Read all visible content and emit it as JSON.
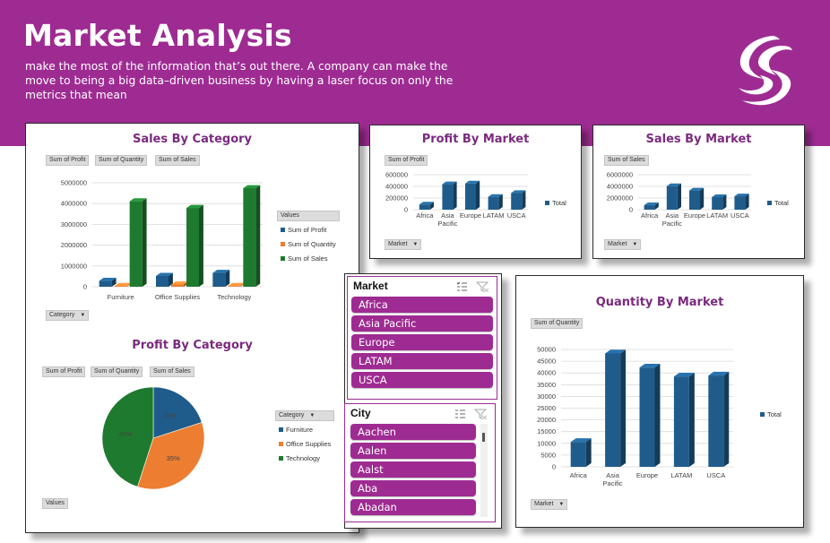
{
  "header": {
    "title": "Market Analysis",
    "subtitle_lines": [
      "make the most of the information that’s out there. A company can make the",
      " move to being a big data–driven business by having a laser focus on only the",
      "metrics that mean"
    ]
  },
  "colors": {
    "banner": "#9e2b92",
    "title_purple": "#7a2a7e",
    "series_blue": "#1f5c8b",
    "series_orange": "#ed7d31",
    "series_green": "#1e7a2f"
  },
  "panels": {
    "sales_by_category": {
      "field_buttons": [
        "Sum of Profit",
        "Sum of Quantity",
        "Sum of Sales"
      ],
      "axis_button": "Category",
      "legend_title": "Values"
    },
    "profit_by_category": {
      "field_buttons": [
        "Sum of Profit",
        "Sum of Quantity",
        "Sum of Sales"
      ],
      "legend_button": "Category",
      "values_button": "Values"
    },
    "profit_by_market": {
      "field_button": "Sum of Profit",
      "axis_button": "Market"
    },
    "sales_by_market": {
      "field_button": "Sum of Sales",
      "axis_button": "Market"
    },
    "quantity_by_market": {
      "field_button": "Sum of Quantity",
      "axis_button": "Market"
    }
  },
  "slicers": {
    "market": {
      "header": "Market",
      "items": [
        "Africa",
        "Asia Pacific",
        "Europe",
        "LATAM",
        "USCA"
      ]
    },
    "city": {
      "header": "City",
      "items": [
        "Aachen",
        "Aalen",
        "Aalst",
        "Aba",
        "Abadan"
      ]
    }
  },
  "chart_data": [
    {
      "id": "sales_by_category",
      "type": "bar",
      "title": "Sales By Category",
      "categories": [
        "Furniture",
        "Office Supplies",
        "Technology"
      ],
      "series": [
        {
          "name": "Sum of Profit",
          "values": [
            285000,
            518000,
            664000
          ]
        },
        {
          "name": "Sum of Quantity",
          "values": [
            35000,
            108000,
            36000
          ]
        },
        {
          "name": "Sum of Sales",
          "values": [
            4110000,
            3790000,
            4740000
          ]
        }
      ],
      "yticks": [
        "0",
        "1000000",
        "2000000",
        "3000000",
        "4000000",
        "5000000"
      ],
      "ylim": [
        0,
        5000000
      ],
      "legend": "right"
    },
    {
      "id": "profit_by_category",
      "type": "pie",
      "title": "Profit By Category",
      "categories": [
        "Furniture",
        "Office Supplies",
        "Technology"
      ],
      "values": [
        20,
        35,
        45
      ],
      "labels": [
        "20%",
        "35%",
        "45%"
      ],
      "legend": "right"
    },
    {
      "id": "profit_by_market",
      "type": "bar",
      "title": "Profit By Market",
      "categories": [
        "Africa",
        "Asia\nPacific",
        "Europe",
        "LATAM",
        "USCA"
      ],
      "series": [
        {
          "name": "Total",
          "values": [
            89000,
            437000,
            450000,
            221000,
            287000
          ]
        }
      ],
      "yticks": [
        "0",
        "200000",
        "400000",
        "600000"
      ],
      "ylim": [
        0,
        600000
      ],
      "legend": "right"
    },
    {
      "id": "sales_by_market",
      "type": "bar",
      "title": "Sales By Market",
      "categories": [
        "Africa",
        "Asia\nPacific",
        "Europe",
        "LATAM",
        "USCA"
      ],
      "series": [
        {
          "name": "Total",
          "values": [
            780000,
            4040000,
            3290000,
            2160000,
            2300000
          ]
        }
      ],
      "yticks": [
        "0",
        "2000000",
        "4000000",
        "6000000"
      ],
      "ylim": [
        0,
        6000000
      ],
      "legend": "right"
    },
    {
      "id": "quantity_by_market",
      "type": "bar",
      "title": "Quantity By Market",
      "categories": [
        "Africa",
        "Asia\nPacific",
        "Europe",
        "LATAM",
        "USCA"
      ],
      "series": [
        {
          "name": "Total",
          "values": [
            10600,
            48300,
            42300,
            38500,
            38900
          ]
        }
      ],
      "yticks": [
        "0",
        "5000",
        "10000",
        "15000",
        "20000",
        "25000",
        "30000",
        "35000",
        "40000",
        "45000",
        "50000"
      ],
      "ylim": [
        0,
        50000
      ],
      "legend": "right"
    }
  ]
}
